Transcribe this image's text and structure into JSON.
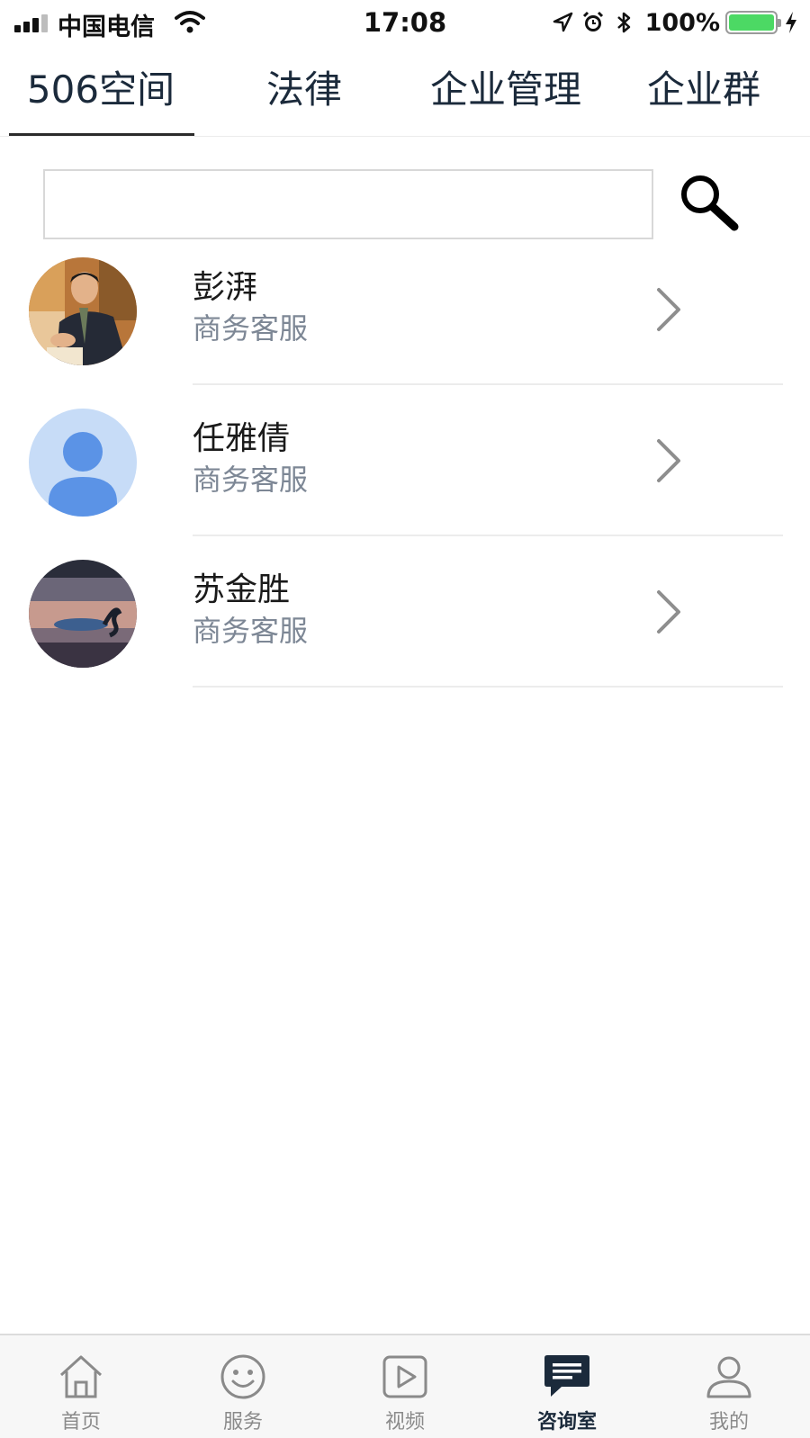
{
  "status_bar": {
    "carrier": "中国电信",
    "time": "17:08",
    "battery_percent": "100%",
    "battery_level": 1.0
  },
  "top_tabs": [
    {
      "label": "506空间",
      "active": true
    },
    {
      "label": "法律",
      "active": false
    },
    {
      "label": "企业管理",
      "active": false
    },
    {
      "label": "企业群",
      "active": false
    }
  ],
  "search": {
    "placeholder": "",
    "value": "",
    "icon": "search-icon"
  },
  "contacts": [
    {
      "name": "彭湃",
      "role": "商务客服",
      "avatar": "photo-man-at-desk"
    },
    {
      "name": "任雅倩",
      "role": "商务客服",
      "avatar": "default-person-avatar"
    },
    {
      "name": "苏金胜",
      "role": "商务客服",
      "avatar": "photo-swan-lake"
    }
  ],
  "bottom_nav": [
    {
      "label": "首页",
      "icon": "home-icon",
      "active": false
    },
    {
      "label": "服务",
      "icon": "smiley-icon",
      "active": false
    },
    {
      "label": "视频",
      "icon": "play-icon",
      "active": false
    },
    {
      "label": "咨询室",
      "icon": "chat-icon",
      "active": true
    },
    {
      "label": "我的",
      "icon": "person-icon",
      "active": false
    }
  ],
  "colors": {
    "tab_text": "#1b2a3b",
    "secondary_text": "#7d8795",
    "battery": "#4cd964",
    "active_nav": "#1b2a3b",
    "inactive_nav": "#8a8a8a",
    "avatar_default_bg": "#c7dcf7",
    "avatar_default_fg": "#5b93e6"
  }
}
